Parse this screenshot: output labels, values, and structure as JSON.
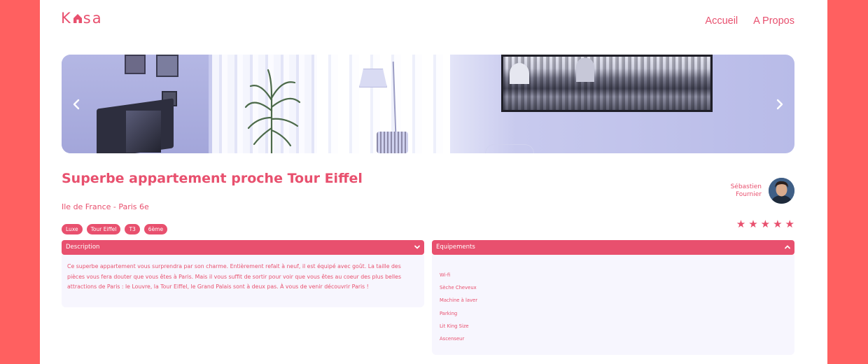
{
  "header": {
    "logo_text_1": "K",
    "logo_text_2": "sa",
    "nav": [
      "Accueil",
      "A Propos"
    ]
  },
  "carousel": {
    "prev_icon": "chevron-left-icon",
    "next_icon": "chevron-right-icon"
  },
  "listing": {
    "title": "Superbe appartement proche Tour Eiffel",
    "location": "Ile de France - Paris 6e",
    "tags": [
      "Luxe",
      "Tour Eiffel",
      "T3",
      "6ème"
    ],
    "host": {
      "first_name": "Sébastien",
      "last_name": "Fournier"
    },
    "rating": 5,
    "rating_max": 5
  },
  "description": {
    "label": "Description",
    "text": "Ce superbe appartement vous surprendra par son charme. Entièrement refait à neuf, il est équipé avec goût. La taille des pièces vous fera douter que vous êtes à Paris. Mais il vous suffit de sortir pour voir que vous êtes au coeur des plus belles attractions de Paris : le Louvre, la Tour Eiffel, le Grand Palais sont à deux pas. À vous de venir découvrir Paris !"
  },
  "equipements": {
    "label": "Equipements",
    "items": [
      "Wi-fi",
      "Sèche Cheveux",
      "Machine à laver",
      "Parking",
      "Lit King Size",
      "Ascenseur"
    ]
  },
  "colors": {
    "accent": "#e8506e",
    "background": "#ff6060",
    "panel_bg": "#f7f6fe"
  }
}
